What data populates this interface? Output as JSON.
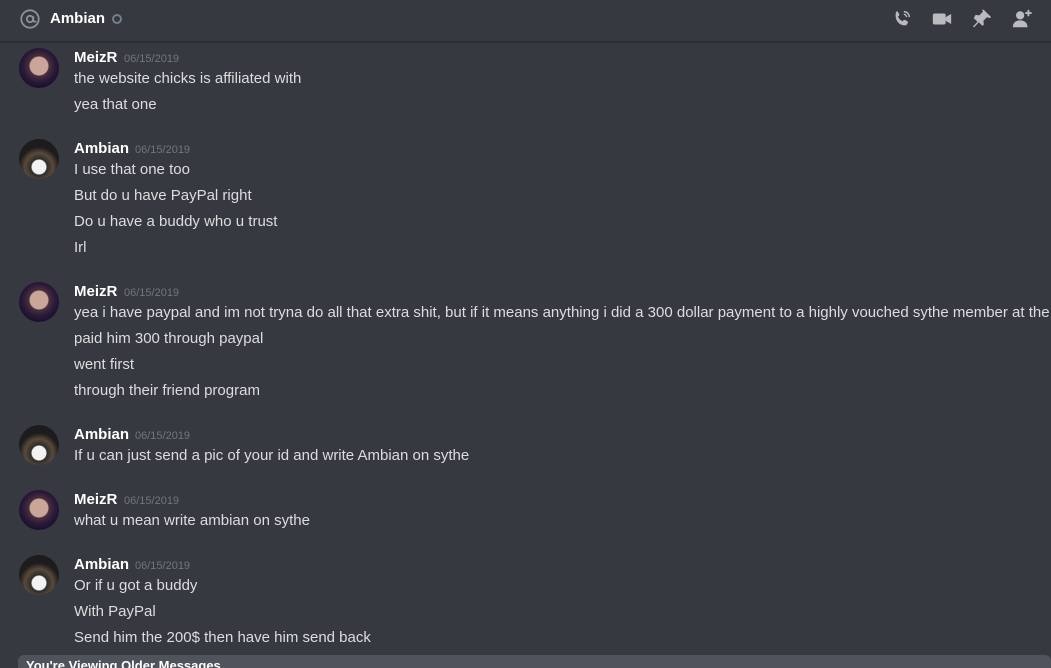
{
  "header": {
    "channel_name": "Ambian",
    "icons": [
      "at-icon",
      "call-icon",
      "video-icon",
      "pin-icon",
      "add-friend-icon"
    ]
  },
  "messages": [
    {
      "author": "MeizR",
      "timestamp": "06/15/2019",
      "lines": [
        "the website chicks is affiliated with",
        "yea that one"
      ]
    },
    {
      "author": "Ambian",
      "timestamp": "06/15/2019",
      "lines": [
        "I use that one too",
        "But do u have PayPal right",
        "Do u have a buddy who u trust",
        "Irl"
      ]
    },
    {
      "author": "MeizR",
      "timestamp": "06/15/2019",
      "lines": [
        "yea i have paypal and im not tryna do all that extra shit, but if it means anything i did a 300 dollar payment to a highly vouched sythe member at the",
        "paid him 300 through paypal",
        "went first",
        "through their friend program"
      ]
    },
    {
      "author": "Ambian",
      "timestamp": "06/15/2019",
      "lines": [
        "If u can just send a pic of your id and write Ambian on sythe"
      ]
    },
    {
      "author": "MeizR",
      "timestamp": "06/15/2019",
      "lines": [
        "what u mean write ambian on sythe"
      ]
    },
    {
      "author": "Ambian",
      "timestamp": "06/15/2019",
      "lines": [
        "Or if u got a buddy",
        "With PayPal",
        "Send him the 200$ then have him send back"
      ]
    }
  ],
  "older_messages_bar": {
    "text": "You're Viewing Older Messages"
  },
  "colors": {
    "background": "#36393f",
    "username": "#ffffff",
    "message_text": "#dcddde",
    "timestamp": "#72767d",
    "bar": "#4f545c"
  }
}
